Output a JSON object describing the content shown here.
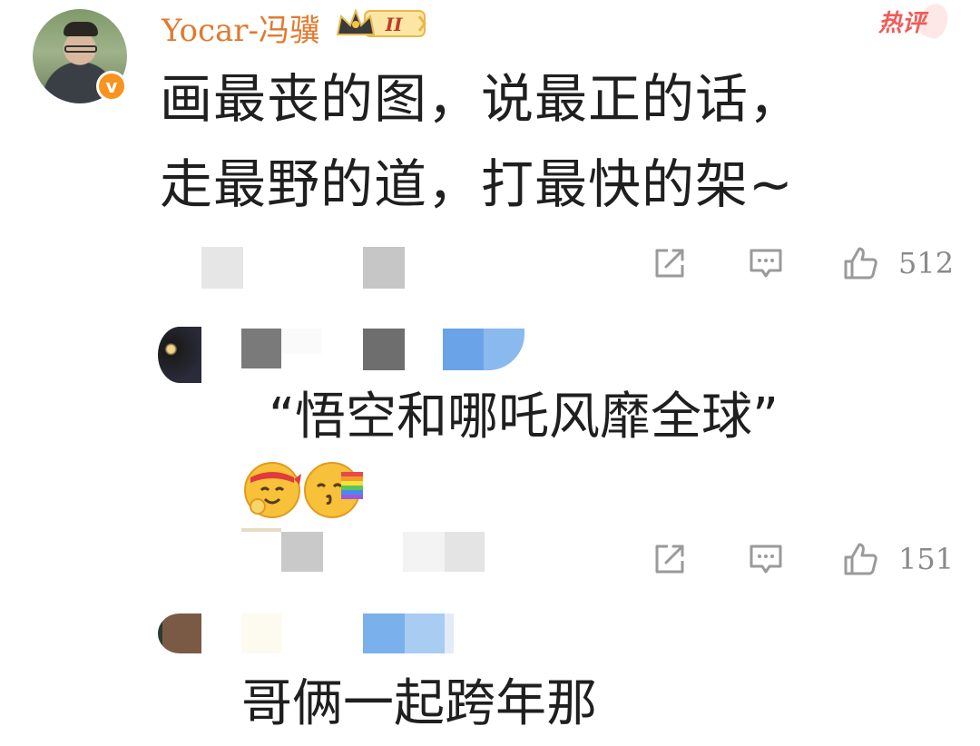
{
  "comment": {
    "username": "Yocar-冯骥",
    "vip_level": "II",
    "hot_label": "热评",
    "verified_mark": "v",
    "text_line1": "画最丧的图，说最正的话，",
    "text_line2": "走最野的道，打最快的架~",
    "like_count": "512"
  },
  "replies": [
    {
      "text": "“悟空和哪吒风靡全球”",
      "emojis": [
        "hug-emoji",
        "rainbow-emoji"
      ],
      "like_count": "151"
    },
    {
      "text": "哥俩一起跨年那"
    }
  ],
  "colors": {
    "username": "#e07a2e",
    "hot": "#f25b57",
    "icon_gray": "#9a9a9a",
    "verified": "#f7931e"
  },
  "icons": [
    "share-icon",
    "comment-icon",
    "like-icon"
  ]
}
